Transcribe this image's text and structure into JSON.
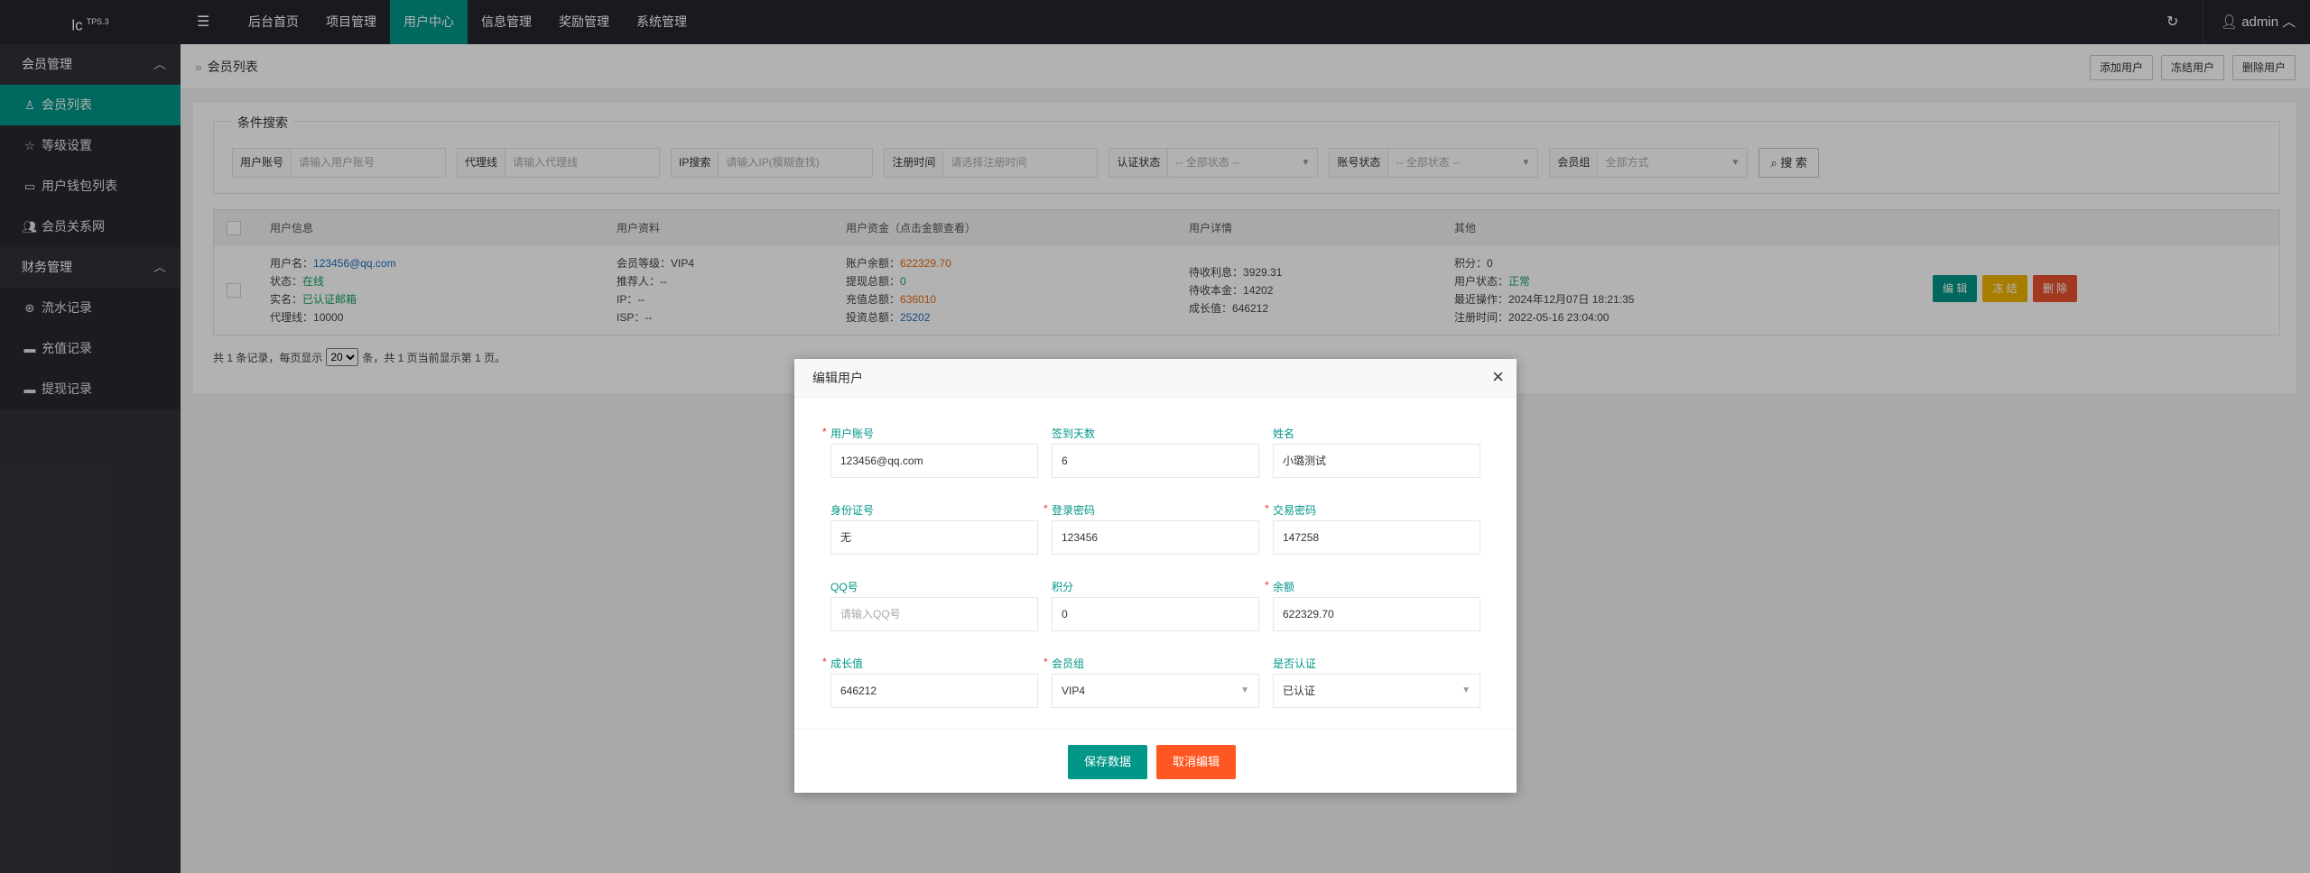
{
  "topbar": {
    "logo": "lc",
    "logo_sup": "TPS.3",
    "menu_glyph": "☰",
    "nav": [
      "后台首页",
      "项目管理",
      "用户中心",
      "信息管理",
      "奖励管理",
      "系统管理"
    ],
    "user": "admin",
    "refresh_glyph": "↻"
  },
  "sidebar": {
    "groups": [
      {
        "label": "会员管理",
        "items": [
          "会员列表",
          "等级设置",
          "用户钱包列表",
          "会员关系网"
        ]
      },
      {
        "label": "财务管理",
        "items": [
          "流水记录",
          "充值记录",
          "提现记录"
        ]
      }
    ]
  },
  "crumb": {
    "label": "会员列表"
  },
  "top_actions": [
    "添加用户",
    "冻结用户",
    "删除用户"
  ],
  "search": {
    "legend": "条件搜索",
    "filters": [
      {
        "label": "用户账号",
        "placeholder": "请输入用户账号"
      },
      {
        "label": "代理线",
        "placeholder": "请输入代理线"
      },
      {
        "label": "IP搜索",
        "placeholder": "请输入IP(模糊查找)"
      },
      {
        "label": "注册时间",
        "placeholder": "请选择注册时间"
      },
      {
        "label": "认证状态",
        "placeholder": "-- 全部状态 --"
      },
      {
        "label": "账号状态",
        "placeholder": "-- 全部状态 --"
      },
      {
        "label": "会员组",
        "placeholder": "全部方式"
      }
    ],
    "button": "搜 索"
  },
  "table": {
    "headers": [
      "用户信息",
      "用户资料",
      "用户资金（点击金额查看）",
      "用户详情",
      "其他"
    ],
    "row": {
      "info": [
        {
          "k": "用户名：",
          "v": "123456@qq.com"
        },
        {
          "k": "状态：",
          "v": "在线"
        },
        {
          "k": "实名：",
          "v": "已认证邮箱"
        },
        {
          "k": "代理线：",
          "v": "10000"
        }
      ],
      "profile": [
        {
          "k": "会员等级：",
          "v": "VIP4"
        },
        {
          "k": "推荐人：",
          "v": "--"
        },
        {
          "k": "IP：",
          "v": "--"
        },
        {
          "k": "ISP：",
          "v": "--"
        }
      ],
      "funds": [
        {
          "k": "账户余额：",
          "v": "622329.70"
        },
        {
          "k": "提现总额：",
          "v": "0"
        },
        {
          "k": "充值总额：",
          "v": "636010"
        },
        {
          "k": "投资总额：",
          "v": "25202"
        }
      ],
      "detail": [
        {
          "k": "待收利息：",
          "v": "3929.31"
        },
        {
          "k": "待收本金：",
          "v": "14202"
        },
        {
          "k": "成长值：",
          "v": "646212"
        }
      ],
      "other": [
        {
          "k": "积分：",
          "v": "0"
        },
        {
          "k": "用户状态：",
          "v": "正常"
        },
        {
          "k": "最近操作：",
          "v": "2024年12月07日 18:21:35"
        },
        {
          "k": "注册时间：",
          "v": "2022-05-16 23:04:00"
        }
      ],
      "actions": [
        "编 辑",
        "冻 结",
        "删 除"
      ]
    }
  },
  "pager": {
    "before": "共 1 条记录，每页显示",
    "page_size": "20",
    "after": "条，共 1 页当前显示第 1 页。"
  },
  "modal": {
    "title": "编辑用户",
    "fields": [
      {
        "label": "用户账号",
        "value": "123456@qq.com",
        "required": "*"
      },
      {
        "label": "签到天数",
        "value": "6",
        "required": ""
      },
      {
        "label": "姓名",
        "value": "小璐测试",
        "required": ""
      },
      {
        "label": "身份证号",
        "value": "无",
        "required": ""
      },
      {
        "label": "登录密码",
        "value": "123456",
        "required": "*"
      },
      {
        "label": "交易密码",
        "value": "147258",
        "required": "*"
      },
      {
        "label": "QQ号",
        "value": "",
        "placeholder": "请输入QQ号",
        "required": ""
      },
      {
        "label": "积分",
        "value": "0",
        "required": ""
      },
      {
        "label": "余额",
        "value": "622329.70",
        "required": "*"
      },
      {
        "label": "成长值",
        "value": "646212",
        "required": "*"
      },
      {
        "label": "会员组",
        "value": "VIP4",
        "required": "*"
      },
      {
        "label": "是否认证",
        "value": "已认证",
        "required": ""
      }
    ],
    "save": "保存数据",
    "cancel": "取消编辑"
  },
  "colors": {
    "accent": "#009688",
    "topbar": "#23262e",
    "sidebar": "#2f323a",
    "danger": "#ff5722"
  }
}
